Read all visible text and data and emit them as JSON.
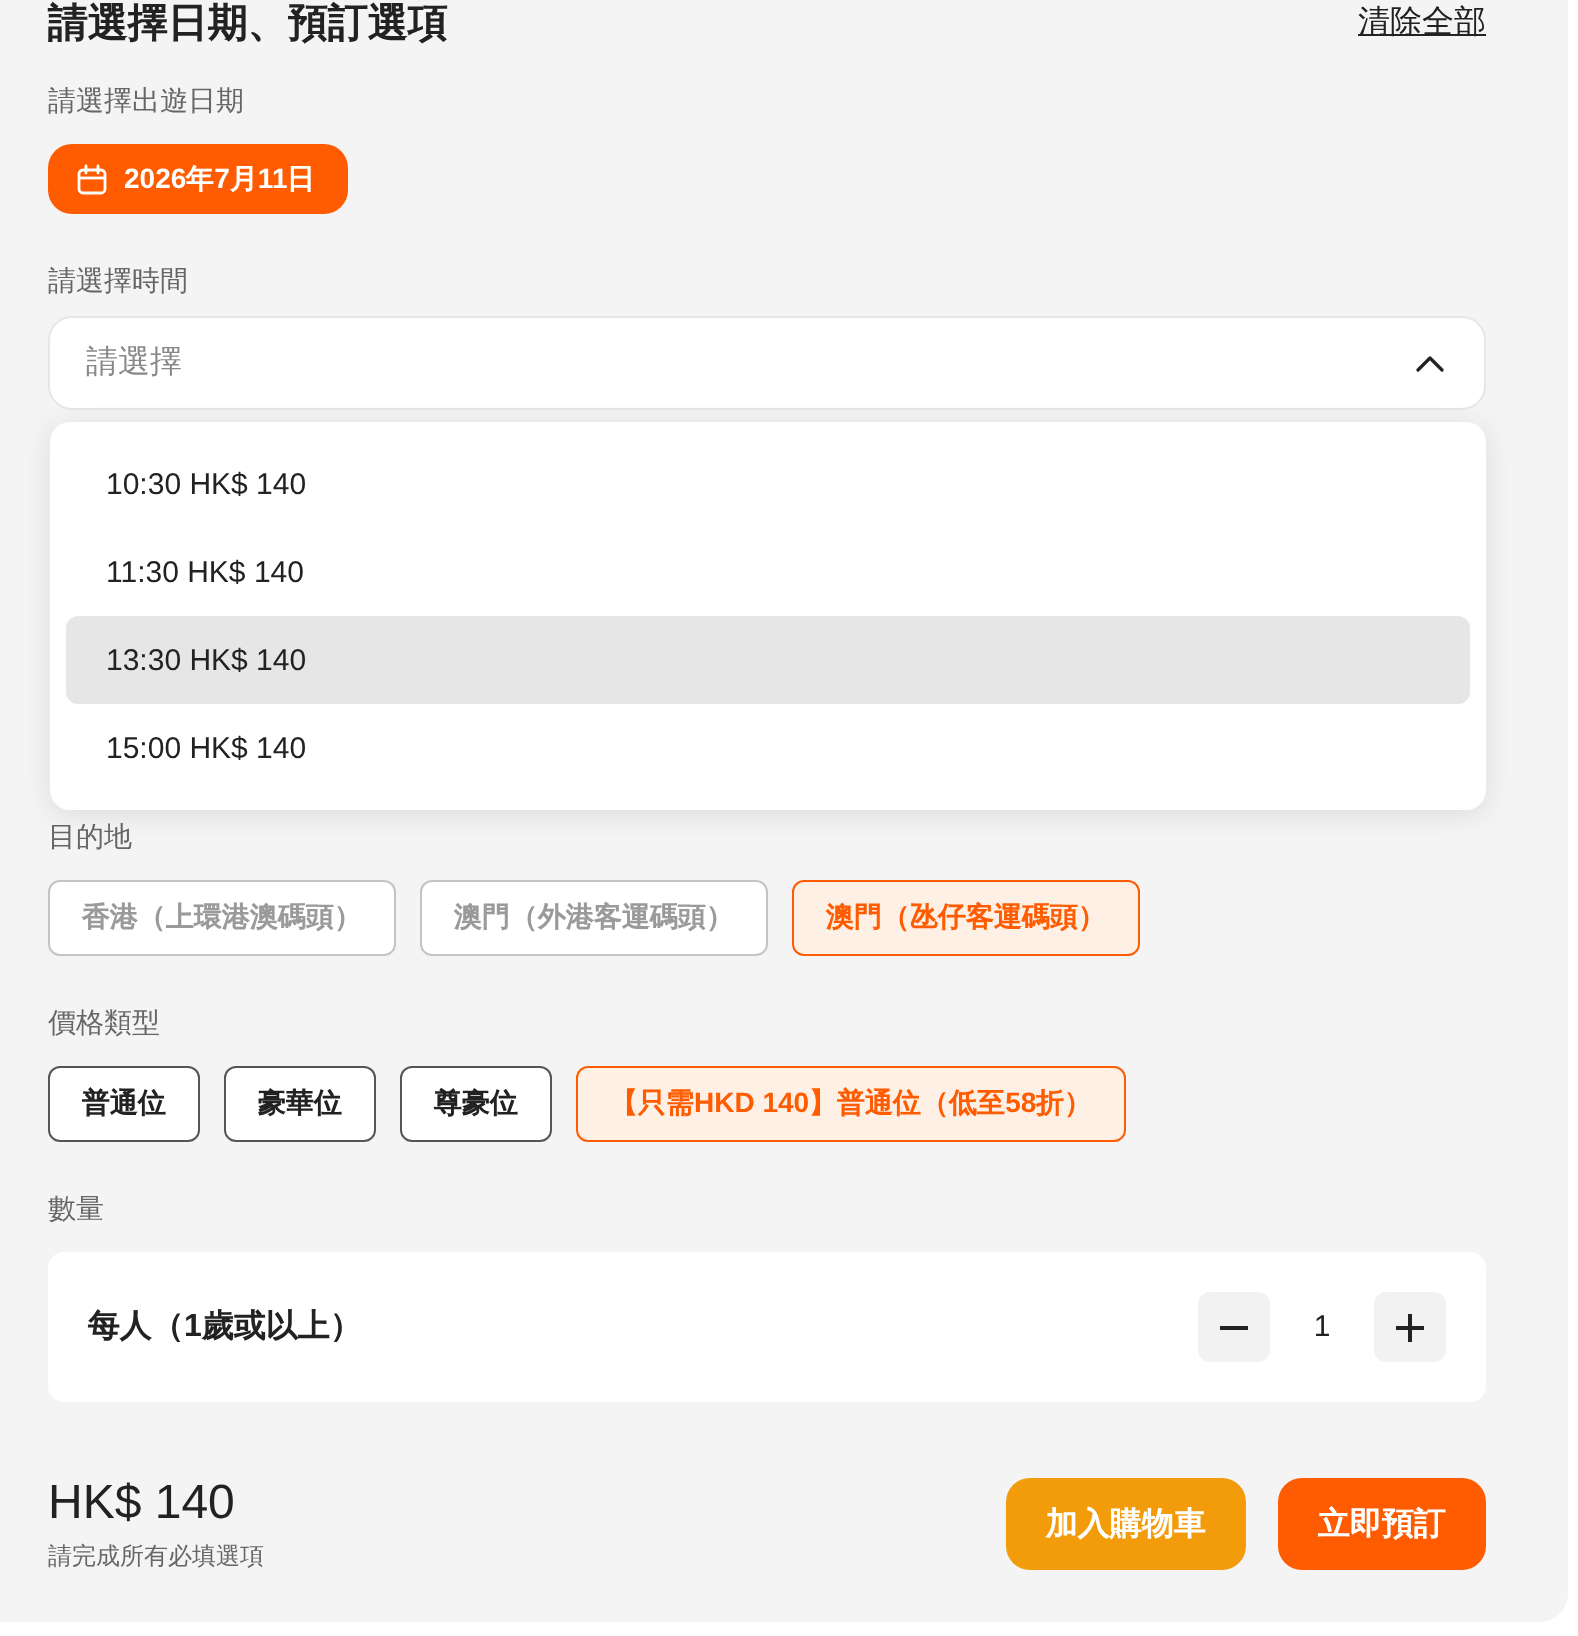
{
  "header": {
    "title": "請選擇日期、預訂選項",
    "clear_link": "清除全部"
  },
  "date": {
    "label": "請選擇出遊日期",
    "value": "2026年7月11日"
  },
  "time": {
    "label": "請選擇時間",
    "placeholder": "請選擇",
    "expanded": true,
    "options": [
      {
        "label": "10:30 HK$ 140",
        "highlighted": false
      },
      {
        "label": "11:30 HK$ 140",
        "highlighted": false
      },
      {
        "label": "13:30 HK$ 140",
        "highlighted": true
      },
      {
        "label": "15:00 HK$ 140",
        "highlighted": false
      }
    ]
  },
  "destination": {
    "label": "目的地",
    "options": [
      {
        "label": "香港（上環港澳碼頭）",
        "selected": false,
        "disabled": true
      },
      {
        "label": "澳門（外港客運碼頭）",
        "selected": false,
        "disabled": true
      },
      {
        "label": "澳門（氹仔客運碼頭）",
        "selected": true,
        "disabled": false
      }
    ]
  },
  "price_type": {
    "label": "價格類型",
    "options": [
      {
        "label": "普通位",
        "selected": false
      },
      {
        "label": "豪華位",
        "selected": false
      },
      {
        "label": "尊豪位",
        "selected": false
      },
      {
        "label": "【只需HKD 140】普通位（低至58折）",
        "selected": true
      }
    ]
  },
  "quantity": {
    "label": "數量",
    "rows": [
      {
        "label": "每人（1歲或以上）",
        "value": "1"
      }
    ]
  },
  "footer": {
    "total": "HK$ 140",
    "note": "請完成所有必填選項",
    "buttons": [
      {
        "label": "加入購物車",
        "kind": "secondary"
      },
      {
        "label": "立即預訂",
        "kind": "primary"
      }
    ]
  }
}
